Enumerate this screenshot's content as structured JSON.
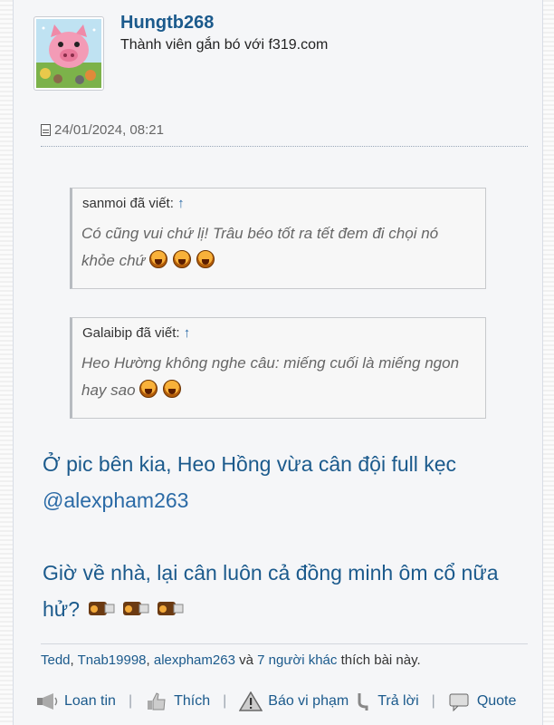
{
  "user": {
    "name": "Hungtb268",
    "title": "Thành viên gắn bó với f319.com"
  },
  "post": {
    "timestamp": "24/01/2024, 08:21"
  },
  "quotes": [
    {
      "author_line": "sanmoi đã viết:",
      "arrow": "↑",
      "text": "Có cũng vui chứ lị! Trâu béo tốt ra tết đem đi chọi nó khỏe chứ"
    },
    {
      "author_line": "Galaibip đã viết:",
      "arrow": "↑",
      "text": "Heo Hường không nghe câu: miếng cuối là miếng ngon hay sao"
    }
  ],
  "message": {
    "line1": "Ở pic bên kia, Heo Hồng vừa cân đội full kẹc",
    "mention": "@alexpham263",
    "line3": "Giờ về nhà, lại cân luôn cả đồng minh ôm cổ nữa hử?"
  },
  "likes": {
    "user1": "Tedd",
    "user2": "Tnab19998",
    "user3": "alexpham263",
    "and": "và",
    "others": "7 người khác",
    "suffix": "thích bài này."
  },
  "actions": {
    "report": "Loan tin",
    "like": "Thích",
    "violation": "Báo vi phạm",
    "reply": "Trả lời",
    "quote": "Quote"
  }
}
